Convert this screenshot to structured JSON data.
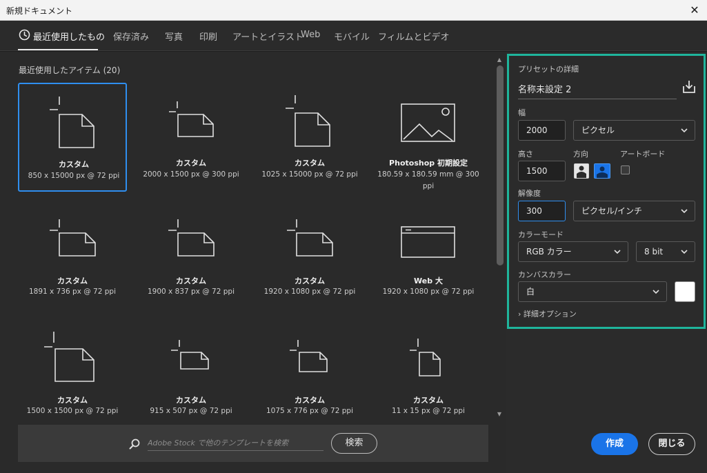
{
  "window": {
    "title": "新規ドキュメント",
    "close_glyph": "✕"
  },
  "tabs": [
    {
      "label": "最近使用したもの",
      "active": true
    },
    {
      "label": "保存済み"
    },
    {
      "label": "写真"
    },
    {
      "label": "印刷"
    },
    {
      "label": "アートとイラスト"
    },
    {
      "label": "Web"
    },
    {
      "label": "モバイル"
    },
    {
      "label": "フィルムとビデオ"
    }
  ],
  "recent": {
    "title": "最近使用したアイテム (20)",
    "items": [
      {
        "name": "カスタム",
        "info": "850 x 15000 px @ 72 ppi",
        "icon": "document-portrait-icon",
        "selected": true
      },
      {
        "name": "カスタム",
        "info": "2000 x 1500 px @ 300 ppi",
        "icon": "document-landscape-icon"
      },
      {
        "name": "カスタム",
        "info": "1025 x 15000 px @ 72 ppi",
        "icon": "document-portrait-icon"
      },
      {
        "name": "Photoshop 初期設定",
        "info": "180.59 x 180.59 mm @ 300 ppi",
        "icon": "image-icon"
      },
      {
        "name": "カスタム",
        "info": "1891 x 736 px @ 72 ppi",
        "icon": "document-landscape-icon"
      },
      {
        "name": "カスタム",
        "info": "1900 x 837 px @ 72 ppi",
        "icon": "document-landscape-icon"
      },
      {
        "name": "カスタム",
        "info": "1920 x 1080 px @ 72 ppi",
        "icon": "document-landscape-icon"
      },
      {
        "name": "Web 大",
        "info": "1920 x 1080 px @ 72 ppi",
        "icon": "web-browser-icon"
      },
      {
        "name": "カスタム",
        "info": "1500 x 1500 px @ 72 ppi",
        "icon": "document-square-icon"
      },
      {
        "name": "カスタム",
        "info": "915 x 507 px @ 72 ppi",
        "icon": "document-landscape-small-icon"
      },
      {
        "name": "カスタム",
        "info": "1075 x 776 px @ 72 ppi",
        "icon": "document-landscape-small-icon"
      },
      {
        "name": "カスタム",
        "info": "11 x 15 px @ 72 ppi",
        "icon": "document-portrait-small-icon"
      }
    ]
  },
  "search": {
    "placeholder": "Adobe Stock で他のテンプレートを検索",
    "button": "検索"
  },
  "preset": {
    "section_title": "プリセットの詳細",
    "doc_name": "名称未設定 2",
    "width_label": "幅",
    "width_value": "2000",
    "width_unit": "ピクセル",
    "height_label": "高さ",
    "height_value": "1500",
    "orientation_label": "方向",
    "artboard_label": "アートボード",
    "resolution_label": "解像度",
    "resolution_value": "300",
    "resolution_unit": "ピクセル/インチ",
    "color_mode_label": "カラーモード",
    "color_mode": "RGB カラー",
    "bit_depth": "8 bit",
    "canvas_color_label": "カンバスカラー",
    "canvas_color": "白",
    "canvas_swatch": "#ffffff",
    "advanced_options": "詳細オプション"
  },
  "actions": {
    "create": "作成",
    "close": "閉じる"
  },
  "colors": {
    "accent": "#1a74e8",
    "highlight": "#1fb59c",
    "selection": "#2f8ff0"
  }
}
